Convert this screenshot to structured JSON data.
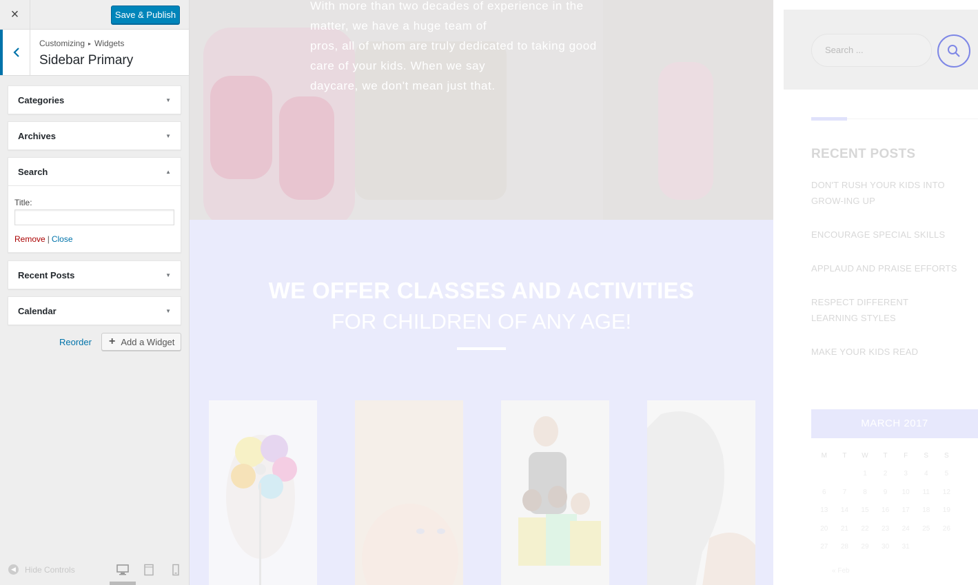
{
  "customizer": {
    "close_icon": "×",
    "save_label": "Save & Publish",
    "breadcrumb_root": "Customizing",
    "breadcrumb_sep": "▸",
    "breadcrumb_child": "Widgets",
    "section_title": "Sidebar Primary",
    "widgets": [
      {
        "title": "Categories",
        "expanded": false
      },
      {
        "title": "Archives",
        "expanded": false
      },
      {
        "title": "Search",
        "expanded": true
      },
      {
        "title": "Recent Posts",
        "expanded": false
      },
      {
        "title": "Calendar",
        "expanded": false
      }
    ],
    "search_widget": {
      "title_label": "Title:",
      "title_value": "",
      "remove_label": "Remove",
      "separator": "|",
      "close_label": "Close"
    },
    "reorder_label": "Reorder",
    "add_widget_label": "Add a Widget",
    "hide_controls_label": "Hide Controls",
    "preview_device": "desktop"
  },
  "preview": {
    "hero_text": "With more than two decades of experience in the matter, we have a huge team of pros, all of whom are truly dedicated to taking good care of your kids. When we say daycare, we don't mean just that.",
    "hero_lines": [
      "With more than two decades of experience in the",
      "matter, we have a huge team of",
      "pros, all of whom are truly dedicated to taking good",
      "care of your kids. When we say",
      "daycare, we don't mean just that."
    ],
    "classes_heading_1": "WE OFFER CLASSES AND ACTIVITIES",
    "classes_heading_2": "FOR CHILDREN OF ANY AGE!",
    "sidebar": {
      "search_placeholder": "Search ...",
      "recent_posts_title": "RECENT POSTS",
      "recent_posts": [
        "DON'T RUSH YOUR KIDS INTO GROW-ING UP",
        "ENCOURAGE SPECIAL SKILLS",
        "APPLAUD AND PRAISE EFFORTS",
        "RESPECT DIFFERENT LEARNING STYLES",
        "MAKE YOUR KIDS READ"
      ],
      "calendar_title": "MARCH 2017",
      "calendar_days": [
        "M",
        "T",
        "W",
        "T",
        "F",
        "S",
        "S"
      ],
      "calendar_weeks": [
        [
          "",
          "",
          "1",
          "2",
          "3",
          "4",
          "5"
        ],
        [
          "6",
          "7",
          "8",
          "9",
          "10",
          "11",
          "12"
        ],
        [
          "13",
          "14",
          "15",
          "16",
          "17",
          "18",
          "19"
        ],
        [
          "20",
          "21",
          "22",
          "23",
          "24",
          "25",
          "26"
        ],
        [
          "27",
          "28",
          "29",
          "30",
          "31",
          "",
          ""
        ]
      ],
      "calendar_prev": "« Feb"
    }
  },
  "colors": {
    "accent": "#0085ba",
    "link": "#0073aa",
    "remove": "#aa0000",
    "brand_purple": "#7e87e6"
  }
}
